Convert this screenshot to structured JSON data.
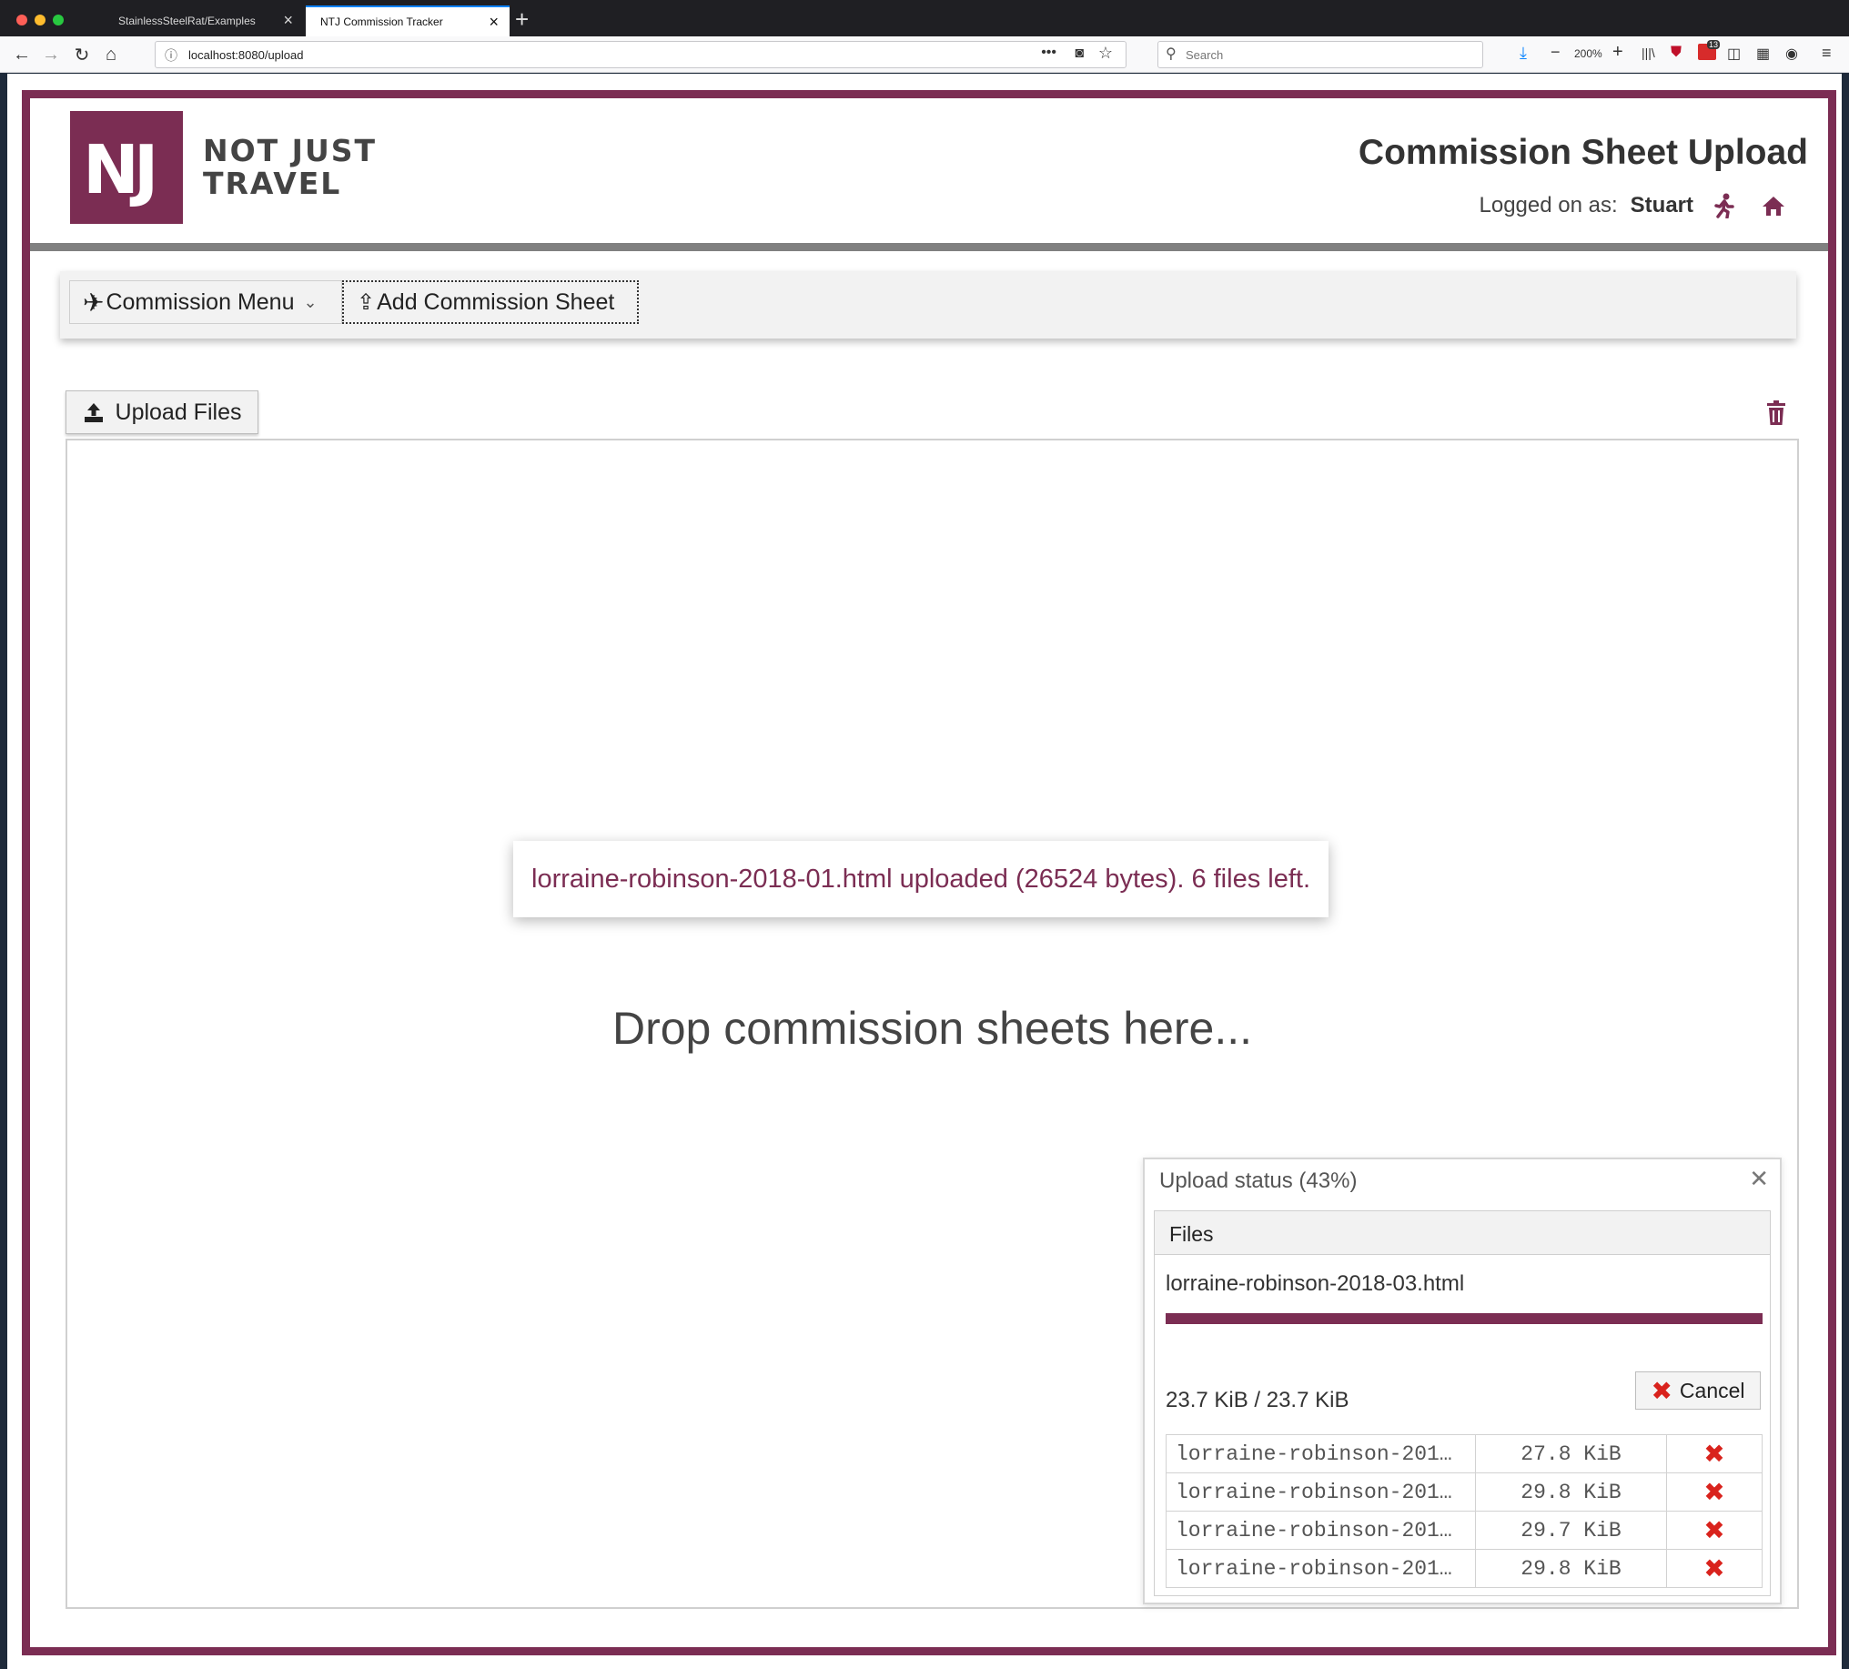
{
  "browser": {
    "tabs": [
      {
        "title": "StainlessSteelRat/Examples",
        "active": false
      },
      {
        "title": "NTJ Commission Tracker",
        "active": true
      }
    ],
    "url": "localhost:8080/upload",
    "search_placeholder": "Search",
    "zoom": "200%",
    "badge_count": "13",
    "accent": "#0a84ff"
  },
  "header": {
    "logo_mark": "NJ",
    "logo_line1": "NOT JUST",
    "logo_line2": "TRAVEL",
    "page_title": "Commission Sheet Upload",
    "logged_label": "Logged on as:",
    "user": "Stuart",
    "brand_color": "#7b2d53"
  },
  "menu": {
    "commission_menu": "Commission Menu",
    "add_sheet": "Add Commission Sheet"
  },
  "upload": {
    "button_label": "Upload Files",
    "drop_text": "Drop commission sheets here...",
    "toast": "lorraine-robinson-2018-01.html uploaded (26524 bytes). 6 files left."
  },
  "status": {
    "title": "Upload status (43%)",
    "files_header": "Files",
    "current_file": "lorraine-robinson-2018-03.html",
    "progress": 1.0,
    "size_text": "23.7 KiB / 23.7 KiB",
    "cancel_label": "Cancel",
    "queue": [
      {
        "name": "lorraine-robinson-201…",
        "size": "27.8 KiB"
      },
      {
        "name": "lorraine-robinson-201…",
        "size": "29.8 KiB"
      },
      {
        "name": "lorraine-robinson-201…",
        "size": "29.7 KiB"
      },
      {
        "name": "lorraine-robinson-201…",
        "size": "29.8 KiB"
      }
    ]
  }
}
